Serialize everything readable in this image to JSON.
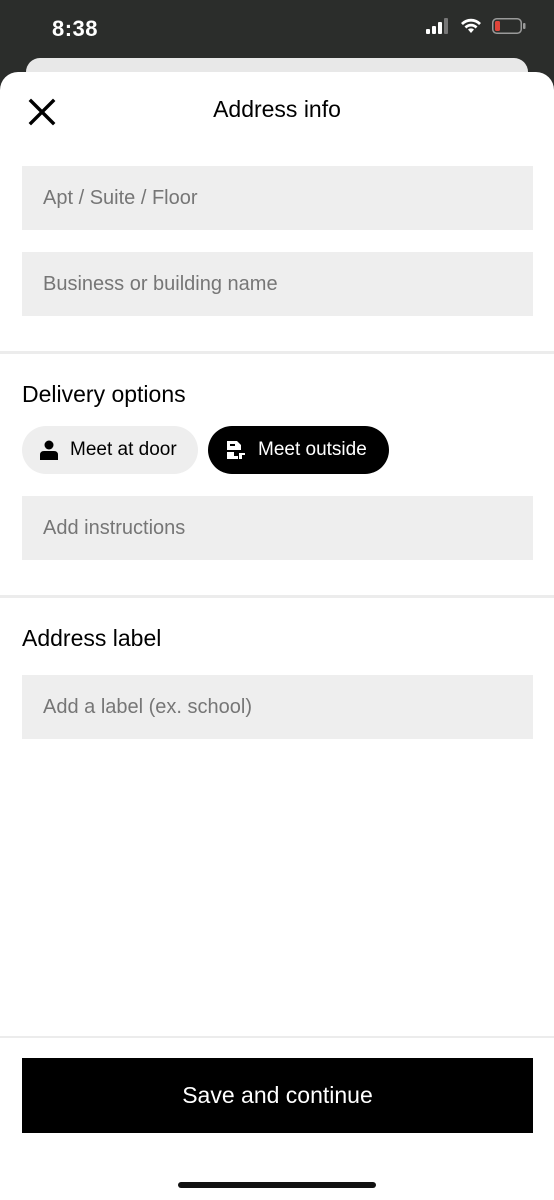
{
  "status_bar": {
    "time": "8:38",
    "icons": [
      "signal-icon",
      "wifi-icon",
      "battery-low-icon"
    ]
  },
  "header": {
    "close_icon": "close-icon",
    "title": "Address info"
  },
  "fields": {
    "apt_placeholder": "Apt / Suite / Floor",
    "business_placeholder": "Business or building name"
  },
  "delivery": {
    "title": "Delivery options",
    "options": [
      {
        "label": "Meet at door",
        "icon": "person-icon",
        "selected": false
      },
      {
        "label": "Meet outside",
        "icon": "handoff-icon",
        "selected": true
      }
    ],
    "instructions_placeholder": "Add instructions"
  },
  "address_label": {
    "title": "Address label",
    "placeholder": "Add a label (ex. school)"
  },
  "footer": {
    "save_label": "Save and continue"
  },
  "colors": {
    "accent": "#000000",
    "field_bg": "#eeeeee",
    "battery_low": "#e0443a"
  }
}
